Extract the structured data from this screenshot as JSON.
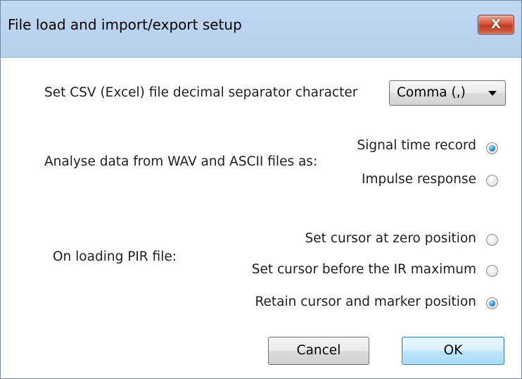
{
  "window": {
    "title": "File load and import/export setup",
    "close_glyph": "X"
  },
  "csv": {
    "label": "Set CSV (Excel) file decimal separator character",
    "selected": "Comma (,)"
  },
  "analyse": {
    "label": "Analyse data from WAV and ASCII files as:",
    "options": [
      {
        "label": "Signal time record",
        "checked": true
      },
      {
        "label": "Impulse response",
        "checked": false
      }
    ]
  },
  "pir": {
    "label": "On loading PIR file:",
    "options": [
      {
        "label": "Set cursor at zero position",
        "checked": false
      },
      {
        "label": "Set cursor before the IR maximum",
        "checked": false
      },
      {
        "label": "Retain cursor and marker position",
        "checked": true
      }
    ]
  },
  "buttons": {
    "cancel": "Cancel",
    "ok": "OK"
  },
  "colors": {
    "titlebar": "#bcd4ef",
    "close_button": "#c13a22",
    "radio_selected": "#2a8fd0",
    "default_button": "#bee6fd"
  }
}
